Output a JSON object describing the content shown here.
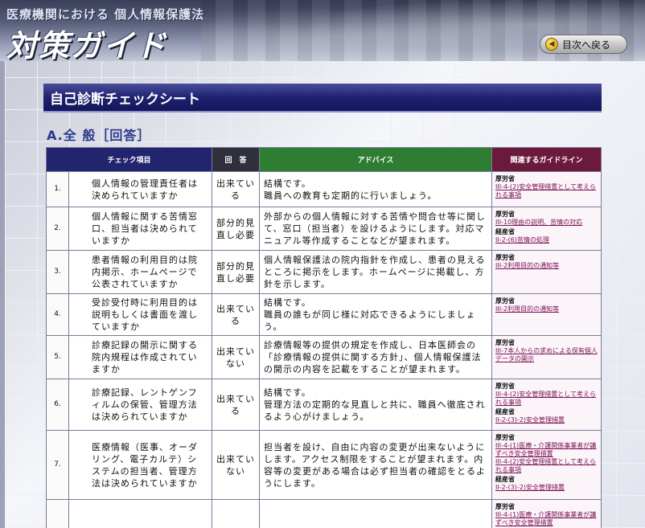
{
  "header": {
    "subtitle": "医療機関における 個人情報保護法",
    "title": "対策ガイド",
    "back_label": "目次へ戻る"
  },
  "section": {
    "title": "自己診断チェックシート",
    "subtitle": "A.全 般［回答］"
  },
  "table": {
    "columns": [
      "チェック項目",
      "回　答",
      "アドバイス",
      "関連するガイドライン"
    ],
    "rows": [
      {
        "num": "1.",
        "item": "個人情報の管理責任者は決められていますか",
        "answer": "出来ている",
        "advice": "結構です。\n職員への教育も定期的に行いましょう。",
        "guides": [
          {
            "head": "厚労省",
            "links": [
              "III-4-(2)安全管理措置として考えられる事項"
            ]
          }
        ]
      },
      {
        "num": "2.",
        "item": "個人情報に関する苦情窓口、担当者は決められていますか",
        "answer": "部分的見直し必要",
        "advice": "外部からの個人情報に対する苦情や問合せ等に関して、窓口（担当者）を設けるようにします。対応マニュアル等作成することなどが望まれます。",
        "guides": [
          {
            "head": "厚労省",
            "links": [
              "III-10理由の説明、苦情の対応"
            ]
          },
          {
            "head": "経産省",
            "links": [
              "II-2-(6)苦情の処理"
            ]
          }
        ]
      },
      {
        "num": "3.",
        "item": "患者情報の利用目的は院内掲示、ホームページで公表されていますか",
        "answer": "部分的見直し必要",
        "advice": "個人情報保護法の院内指針を作成し、患者の見えるところに掲示をします。ホームページに掲載し、方針を示します。",
        "guides": [
          {
            "head": "厚労省",
            "links": [
              "III-2利用目的の通知等"
            ]
          }
        ]
      },
      {
        "num": "4.",
        "item": "受診受付時に利用目的は説明もしくは書面を渡していますか",
        "answer": "出来ている",
        "advice": "結構です。\n職員の誰もが同じ様に対応できるようにしましょう。",
        "guides": [
          {
            "head": "厚労省",
            "links": [
              "III-2利用目的の通知等"
            ]
          }
        ]
      },
      {
        "num": "5.",
        "item": "診療記録の開示に関する院内規程は作成されていますか",
        "answer": "出来ていない",
        "advice": "診療情報等の提供の規定を作成し、日本医師会の「診療情報の提供に関する方針」、個人情報保護法の開示の内容を記載をすることが望まれます。",
        "guides": [
          {
            "head": "厚労省",
            "links": [
              "III-7本人からの求めによる保有個人データの開示"
            ]
          }
        ]
      },
      {
        "num": "6.",
        "item": "診療記録、レントゲンフィルムの保管、管理方法は決められていますか",
        "answer": "出来ている",
        "advice": "結構です。\n管理方法の定期的な見直しと共に、職員へ徹底されるよう心がけましょう。",
        "guides": [
          {
            "head": "厚労省",
            "links": [
              "III-4-(2)安全管理措置として考えられる事項"
            ]
          },
          {
            "head": "経産省",
            "links": [
              "II-2-(3)-2)安全管理措置"
            ]
          }
        ]
      },
      {
        "num": "7.",
        "item": "医療情報（医事、オーダリング、電子カルテ）システムの担当者、管理方法は決められていますか",
        "answer": "出来ていない",
        "advice": "担当者を設け、自由に内容の変更が出来ないようにします。アクセス制限をすることが望まれます。内容等の変更がある場合は必ず担当者の確認をとるようにします。",
        "guides": [
          {
            "head": "厚労省",
            "links": [
              "III-4-(1)医療・介護関係事業者が講ずべき安全管理措置",
              "III-4-(2)安全管理措置として考えられる事項"
            ]
          },
          {
            "head": "経産省",
            "links": [
              "II-2-(3)-2)安全管理措置"
            ]
          }
        ]
      },
      {
        "num": "",
        "item": "",
        "answer": "",
        "advice": "",
        "guides": [
          {
            "head": "厚労省",
            "links": [
              "III-4-(1)医療・介護関係事業者が講ずべき安全管理措置"
            ]
          }
        ]
      }
    ]
  }
}
